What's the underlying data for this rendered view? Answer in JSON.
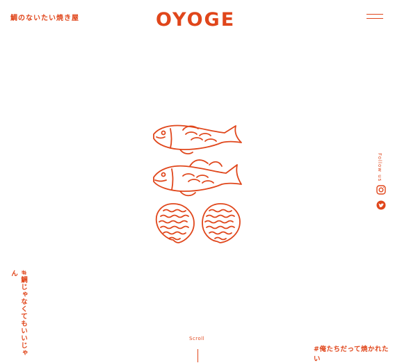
{
  "header": {
    "tagline": "鯛のないたい焼き屋",
    "logo": "OYOGE"
  },
  "colors": {
    "accent": "#e0461b",
    "background": "#ffffff"
  },
  "illustration": {
    "icons": [
      "fish-icon",
      "fish-icon",
      "scallop-icon",
      "scallop-icon"
    ]
  },
  "social": {
    "follow_label": "Follow us",
    "icons": [
      "instagram-icon",
      "twitter-icon"
    ]
  },
  "hashtags": {
    "left": "#鯛じゃなくてもいいじゃん",
    "right": "#俺たちだって焼かれたい"
  },
  "scroll": {
    "label": "Scroll"
  }
}
